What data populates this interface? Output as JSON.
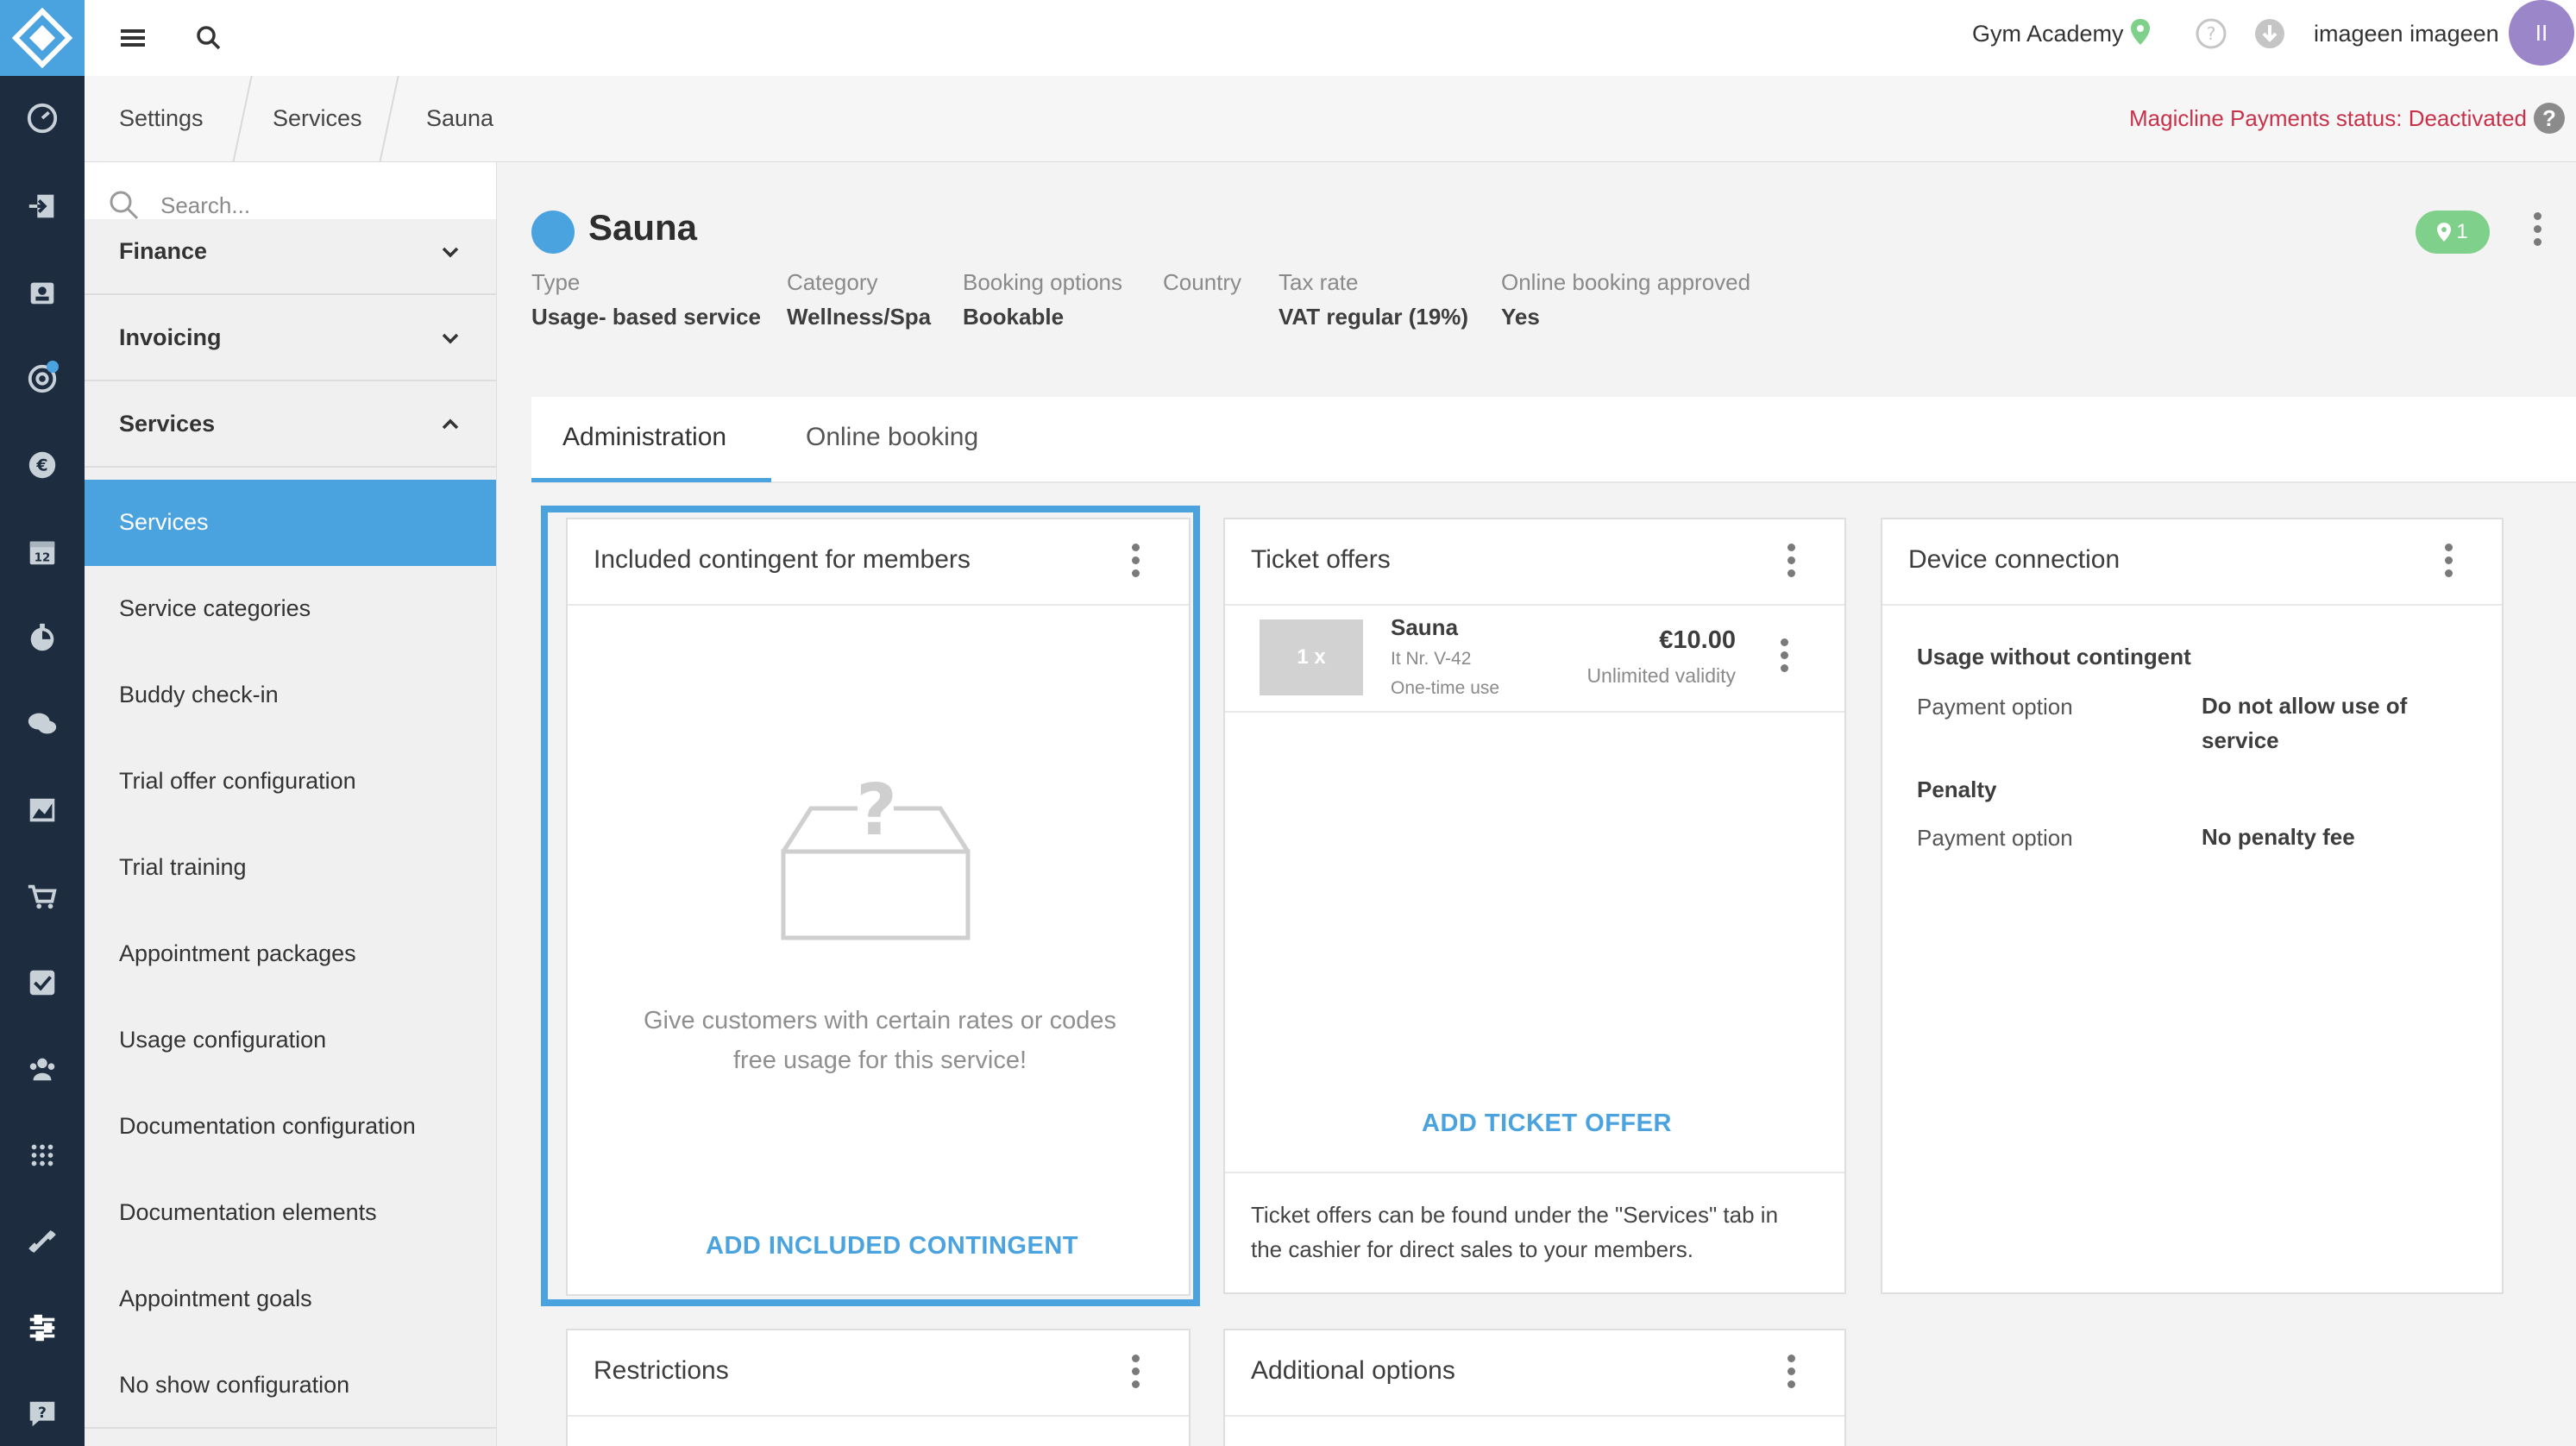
{
  "topbar": {
    "studio": "Gym Academy",
    "user": "imageen imageen",
    "avatar_initials": "II"
  },
  "breadcrumb": [
    "Settings",
    "Services",
    "Sauna"
  ],
  "payments_status": "Magicline Payments status: Deactivated",
  "sidebar": {
    "search_placeholder": "Search...",
    "groups": [
      {
        "label": "Finance",
        "expanded": false
      },
      {
        "label": "Invoicing",
        "expanded": false
      },
      {
        "label": "Services",
        "expanded": true
      }
    ],
    "items": [
      {
        "label": "Services",
        "active": true
      },
      {
        "label": "Service categories"
      },
      {
        "label": "Buddy check-in"
      },
      {
        "label": "Trial offer configuration"
      },
      {
        "label": "Trial training"
      },
      {
        "label": "Appointment packages"
      },
      {
        "label": "Usage configuration"
      },
      {
        "label": "Documentation configuration"
      },
      {
        "label": "Documentation elements"
      },
      {
        "label": "Appointment goals"
      },
      {
        "label": "No show configuration"
      }
    ]
  },
  "service": {
    "name": "Sauna",
    "color": "#4aa3df",
    "location_count": "1",
    "meta": [
      {
        "label": "Type",
        "value": "Usage- based service"
      },
      {
        "label": "Category",
        "value": "Wellness/Spa"
      },
      {
        "label": "Booking options",
        "value": "Bookable"
      },
      {
        "label": "Country",
        "value": ""
      },
      {
        "label": "Tax rate",
        "value": "VAT regular (19%)"
      },
      {
        "label": "Online booking approved",
        "value": "Yes"
      }
    ]
  },
  "tabs": [
    {
      "label": "Administration",
      "active": true
    },
    {
      "label": "Online booking"
    }
  ],
  "cards": {
    "included": {
      "title": "Included contingent for members",
      "empty_text": "Give customers with certain rates or codes free usage for this service!",
      "action": "ADD INCLUDED CONTINGENT"
    },
    "tickets": {
      "title": "Ticket offers",
      "ticket": {
        "qty": "1 x",
        "name": "Sauna",
        "item_no": "It Nr. V-42",
        "usage": "One-time use",
        "price": "€10.00",
        "validity": "Unlimited validity"
      },
      "action": "ADD TICKET OFFER",
      "note": "Ticket offers can be found under the \"Services\" tab in the cashier for direct sales to your members."
    },
    "device": {
      "title": "Device connection",
      "section1": "Usage without contingent",
      "payment_label_1": "Payment option",
      "payment_value_1": "Do not allow use of service",
      "section2": "Penalty",
      "payment_label_2": "Payment option",
      "payment_value_2": "No penalty fee"
    },
    "restrictions": {
      "title": "Restrictions"
    },
    "additional": {
      "title": "Additional options"
    }
  },
  "colors": {
    "accent": "#4aa3df",
    "rail": "#1d2d3f",
    "status_red": "#c9314a",
    "badge_green": "#7fd08a"
  }
}
